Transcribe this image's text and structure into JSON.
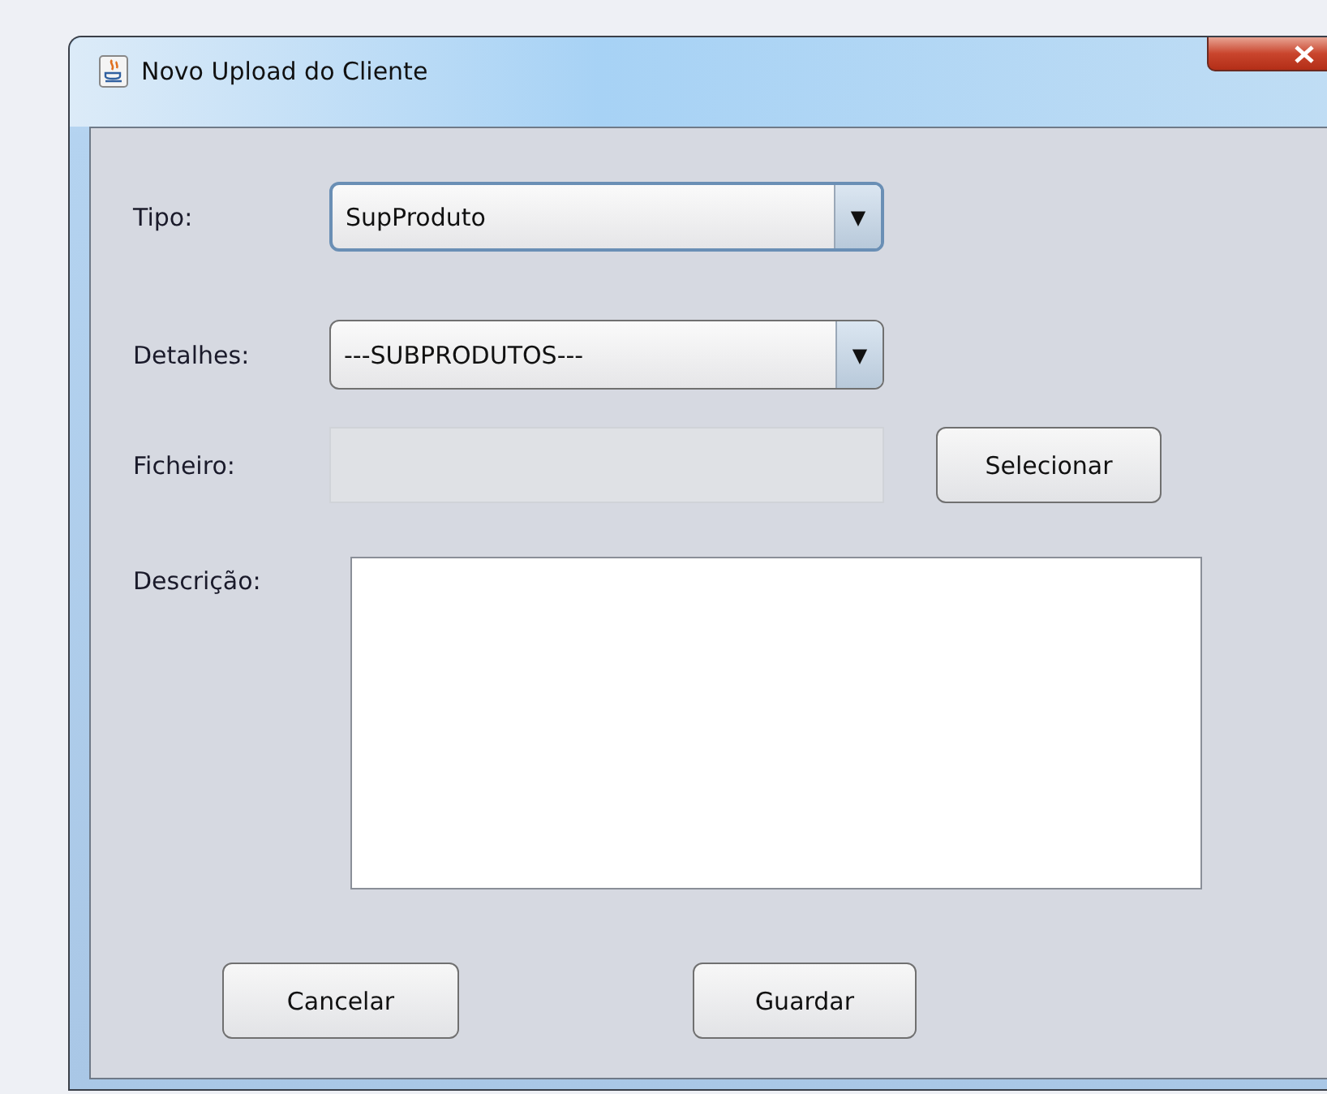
{
  "window": {
    "title": "Novo Upload do Cliente"
  },
  "form": {
    "tipo": {
      "label": "Tipo:",
      "value": "SupProduto",
      "arrow": "▼",
      "focused": true
    },
    "detalhes": {
      "label": "Detalhes:",
      "value": "---SUBPRODUTOS---",
      "arrow": "▼",
      "focused": false
    },
    "ficheiro": {
      "label": "Ficheiro:",
      "disabled": true,
      "button": "Selecionar"
    },
    "descricao": {
      "label": "Descrição:"
    }
  },
  "buttons": [
    "Cancelar",
    "Guardar"
  ]
}
